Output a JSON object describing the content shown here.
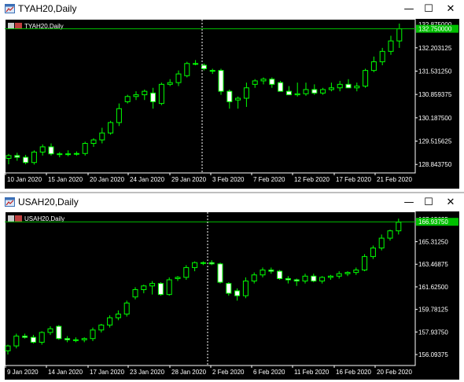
{
  "windows": [
    {
      "title": "TYAH20,Daily",
      "chart_label": "TYAH20,Daily",
      "controls": {
        "minimize": "—",
        "maximize": "☐",
        "close": "✕"
      },
      "chart_data": {
        "type": "candlestick",
        "symbol": "TYAH20",
        "timeframe": "Daily",
        "current_price": "132.750000",
        "y_ticks": [
          "132.875000",
          "132.203125",
          "131.531250",
          "130.859375",
          "130.187500",
          "129.515625",
          "128.843750"
        ],
        "x_ticks": [
          "10 Jan 2020",
          "15 Jan 2020",
          "20 Jan 2020",
          "24 Jan 2020",
          "29 Jan 2020",
          "3 Feb 2020",
          "7 Feb 2020",
          "12 Feb 2020",
          "17 Feb 2020",
          "21 Feb 2020"
        ],
        "ylim": [
          128.6,
          132.9
        ],
        "grid": false,
        "colors": {
          "bull_body": "#000000",
          "bear_body": "#ffffff",
          "wick": "#00ff00",
          "axis_text": "#ffffff",
          "price_label_bg": "#00c000",
          "period_separator": "#ffffff"
        },
        "candles": [
          {
            "o": 129.02,
            "h": 129.15,
            "l": 128.85,
            "c": 129.1
          },
          {
            "o": 129.1,
            "h": 129.18,
            "l": 128.95,
            "c": 129.05
          },
          {
            "o": 129.05,
            "h": 129.12,
            "l": 128.85,
            "c": 128.9
          },
          {
            "o": 128.9,
            "h": 129.25,
            "l": 128.84,
            "c": 129.2
          },
          {
            "o": 129.2,
            "h": 129.42,
            "l": 129.1,
            "c": 129.35
          },
          {
            "o": 129.35,
            "h": 129.45,
            "l": 129.1,
            "c": 129.15
          },
          {
            "o": 129.15,
            "h": 129.2,
            "l": 129.05,
            "c": 129.15
          },
          {
            "o": 129.15,
            "h": 129.25,
            "l": 129.08,
            "c": 129.15
          },
          {
            "o": 129.15,
            "h": 129.22,
            "l": 129.1,
            "c": 129.16
          },
          {
            "o": 129.16,
            "h": 129.5,
            "l": 129.1,
            "c": 129.45
          },
          {
            "o": 129.45,
            "h": 129.6,
            "l": 129.35,
            "c": 129.55
          },
          {
            "o": 129.55,
            "h": 129.9,
            "l": 129.45,
            "c": 129.75
          },
          {
            "o": 129.75,
            "h": 130.1,
            "l": 129.7,
            "c": 130.05
          },
          {
            "o": 130.05,
            "h": 130.6,
            "l": 129.95,
            "c": 130.45
          },
          {
            "o": 130.65,
            "h": 130.85,
            "l": 130.6,
            "c": 130.8
          },
          {
            "o": 130.8,
            "h": 130.95,
            "l": 130.7,
            "c": 130.85
          },
          {
            "o": 130.85,
            "h": 131.0,
            "l": 130.7,
            "c": 130.95
          },
          {
            "o": 130.9,
            "h": 131.05,
            "l": 130.45,
            "c": 130.65
          },
          {
            "o": 130.6,
            "h": 131.2,
            "l": 130.55,
            "c": 131.15
          },
          {
            "o": 131.15,
            "h": 131.3,
            "l": 131.1,
            "c": 131.2
          },
          {
            "o": 131.2,
            "h": 131.55,
            "l": 131.1,
            "c": 131.45
          },
          {
            "o": 131.4,
            "h": 131.8,
            "l": 131.35,
            "c": 131.75
          },
          {
            "o": 131.75,
            "h": 131.85,
            "l": 131.7,
            "c": 131.75
          },
          {
            "o": 131.7,
            "h": 131.75,
            "l": 131.55,
            "c": 131.6
          },
          {
            "o": 131.55,
            "h": 131.6,
            "l": 131.45,
            "c": 131.55
          },
          {
            "o": 131.55,
            "h": 131.6,
            "l": 130.85,
            "c": 130.95
          },
          {
            "o": 130.95,
            "h": 131.0,
            "l": 130.45,
            "c": 130.65
          },
          {
            "o": 130.7,
            "h": 130.8,
            "l": 130.45,
            "c": 130.75
          },
          {
            "o": 130.75,
            "h": 131.2,
            "l": 130.5,
            "c": 131.05
          },
          {
            "o": 131.15,
            "h": 131.3,
            "l": 131.05,
            "c": 131.25
          },
          {
            "o": 131.25,
            "h": 131.35,
            "l": 131.15,
            "c": 131.3
          },
          {
            "o": 131.3,
            "h": 131.35,
            "l": 131.05,
            "c": 131.15
          },
          {
            "o": 131.2,
            "h": 131.25,
            "l": 130.95,
            "c": 130.95
          },
          {
            "o": 130.95,
            "h": 131.1,
            "l": 130.85,
            "c": 130.85
          },
          {
            "o": 130.85,
            "h": 131.2,
            "l": 130.8,
            "c": 130.88
          },
          {
            "o": 130.88,
            "h": 131.2,
            "l": 130.82,
            "c": 131.0
          },
          {
            "o": 131.0,
            "h": 131.15,
            "l": 130.85,
            "c": 130.9
          },
          {
            "o": 130.9,
            "h": 131.05,
            "l": 130.85,
            "c": 131.0
          },
          {
            "o": 131.0,
            "h": 131.2,
            "l": 130.95,
            "c": 131.05
          },
          {
            "o": 131.05,
            "h": 131.25,
            "l": 130.95,
            "c": 131.15
          },
          {
            "o": 131.15,
            "h": 131.3,
            "l": 131.05,
            "c": 131.05
          },
          {
            "o": 131.05,
            "h": 131.2,
            "l": 130.95,
            "c": 131.1
          },
          {
            "o": 131.1,
            "h": 131.6,
            "l": 131.05,
            "c": 131.55
          },
          {
            "o": 131.55,
            "h": 131.95,
            "l": 131.5,
            "c": 131.8
          },
          {
            "o": 131.8,
            "h": 132.2,
            "l": 131.7,
            "c": 132.1
          },
          {
            "o": 132.1,
            "h": 132.55,
            "l": 132.0,
            "c": 132.4
          },
          {
            "o": 132.4,
            "h": 132.9,
            "l": 132.2,
            "c": 132.75
          }
        ]
      }
    },
    {
      "title": "USAH20,Daily",
      "chart_label": "USAH20,Daily",
      "controls": {
        "minimize": "—",
        "maximize": "☐",
        "close": "✕"
      },
      "chart_data": {
        "type": "candlestick",
        "symbol": "USAH20",
        "timeframe": "Daily",
        "current_price": "166.93750",
        "y_ticks": [
          "167.15625",
          "165.31250",
          "163.46875",
          "161.62500",
          "159.78125",
          "157.93750",
          "156.09375"
        ],
        "x_ticks": [
          "9 Jan 2020",
          "14 Jan 2020",
          "17 Jan 2020",
          "23 Jan 2020",
          "28 Jan 2020",
          "2 Feb 2020",
          "6 Feb 2020",
          "11 Feb 2020",
          "16 Feb 2020",
          "20 Feb 2020"
        ],
        "ylim": [
          155.2,
          167.4
        ],
        "grid": false,
        "colors": {
          "bull_body": "#000000",
          "bear_body": "#ffffff",
          "wick": "#00ff00",
          "axis_text": "#ffffff",
          "price_label_bg": "#00c000",
          "period_separator": "#ffffff"
        },
        "candles": [
          {
            "o": 156.4,
            "h": 156.9,
            "l": 156.1,
            "c": 156.8
          },
          {
            "o": 156.8,
            "h": 157.8,
            "l": 156.6,
            "c": 157.6
          },
          {
            "o": 157.6,
            "h": 157.8,
            "l": 157.4,
            "c": 157.5
          },
          {
            "o": 157.5,
            "h": 157.7,
            "l": 157.0,
            "c": 157.1
          },
          {
            "o": 157.1,
            "h": 158.0,
            "l": 156.9,
            "c": 157.9
          },
          {
            "o": 157.9,
            "h": 158.4,
            "l": 157.7,
            "c": 158.2
          },
          {
            "o": 158.4,
            "h": 158.5,
            "l": 157.3,
            "c": 157.4
          },
          {
            "o": 157.4,
            "h": 157.6,
            "l": 157.1,
            "c": 157.3
          },
          {
            "o": 157.3,
            "h": 157.5,
            "l": 157.1,
            "c": 157.3
          },
          {
            "o": 157.3,
            "h": 157.5,
            "l": 157.1,
            "c": 157.4
          },
          {
            "o": 157.4,
            "h": 158.3,
            "l": 157.2,
            "c": 158.1
          },
          {
            "o": 158.1,
            "h": 158.6,
            "l": 157.9,
            "c": 158.5
          },
          {
            "o": 158.5,
            "h": 159.3,
            "l": 158.3,
            "c": 159.1
          },
          {
            "o": 159.1,
            "h": 159.7,
            "l": 158.9,
            "c": 159.4
          },
          {
            "o": 159.4,
            "h": 160.5,
            "l": 159.2,
            "c": 160.3
          },
          {
            "o": 160.8,
            "h": 161.6,
            "l": 160.6,
            "c": 161.4
          },
          {
            "o": 161.4,
            "h": 161.8,
            "l": 161.1,
            "c": 161.7
          },
          {
            "o": 161.7,
            "h": 162.1,
            "l": 161.0,
            "c": 161.9
          },
          {
            "o": 161.9,
            "h": 162.0,
            "l": 160.9,
            "c": 161.0
          },
          {
            "o": 161.0,
            "h": 162.4,
            "l": 160.9,
            "c": 162.2
          },
          {
            "o": 162.3,
            "h": 162.5,
            "l": 162.1,
            "c": 162.4
          },
          {
            "o": 162.4,
            "h": 163.4,
            "l": 162.2,
            "c": 163.2
          },
          {
            "o": 163.2,
            "h": 163.7,
            "l": 162.9,
            "c": 163.6
          },
          {
            "o": 163.6,
            "h": 163.7,
            "l": 163.4,
            "c": 163.6
          },
          {
            "o": 163.6,
            "h": 163.8,
            "l": 163.4,
            "c": 163.5
          },
          {
            "o": 163.5,
            "h": 163.6,
            "l": 161.9,
            "c": 162.0
          },
          {
            "o": 161.9,
            "h": 162.0,
            "l": 160.9,
            "c": 161.1
          },
          {
            "o": 161.3,
            "h": 161.5,
            "l": 160.5,
            "c": 160.9
          },
          {
            "o": 160.9,
            "h": 162.4,
            "l": 160.7,
            "c": 162.1
          },
          {
            "o": 162.1,
            "h": 162.8,
            "l": 161.9,
            "c": 162.6
          },
          {
            "o": 162.6,
            "h": 163.2,
            "l": 162.4,
            "c": 163.0
          },
          {
            "o": 163.0,
            "h": 163.2,
            "l": 162.7,
            "c": 162.9
          },
          {
            "o": 162.9,
            "h": 163.0,
            "l": 162.2,
            "c": 162.3
          },
          {
            "o": 162.3,
            "h": 162.5,
            "l": 161.9,
            "c": 162.2
          },
          {
            "o": 162.2,
            "h": 162.3,
            "l": 161.7,
            "c": 162.1
          },
          {
            "o": 162.1,
            "h": 162.7,
            "l": 161.9,
            "c": 162.5
          },
          {
            "o": 162.5,
            "h": 162.7,
            "l": 162.0,
            "c": 162.1
          },
          {
            "o": 162.1,
            "h": 162.5,
            "l": 161.9,
            "c": 162.4
          },
          {
            "o": 162.4,
            "h": 162.6,
            "l": 162.2,
            "c": 162.5
          },
          {
            "o": 162.5,
            "h": 162.9,
            "l": 162.3,
            "c": 162.7
          },
          {
            "o": 162.7,
            "h": 162.9,
            "l": 162.5,
            "c": 162.8
          },
          {
            "o": 162.8,
            "h": 163.2,
            "l": 162.6,
            "c": 163.0
          },
          {
            "o": 163.0,
            "h": 164.3,
            "l": 162.9,
            "c": 164.1
          },
          {
            "o": 164.1,
            "h": 165.0,
            "l": 163.9,
            "c": 164.8
          },
          {
            "o": 164.8,
            "h": 165.9,
            "l": 164.6,
            "c": 165.6
          },
          {
            "o": 165.6,
            "h": 166.3,
            "l": 165.4,
            "c": 166.2
          },
          {
            "o": 166.2,
            "h": 167.2,
            "l": 165.9,
            "c": 166.9
          }
        ]
      }
    }
  ]
}
